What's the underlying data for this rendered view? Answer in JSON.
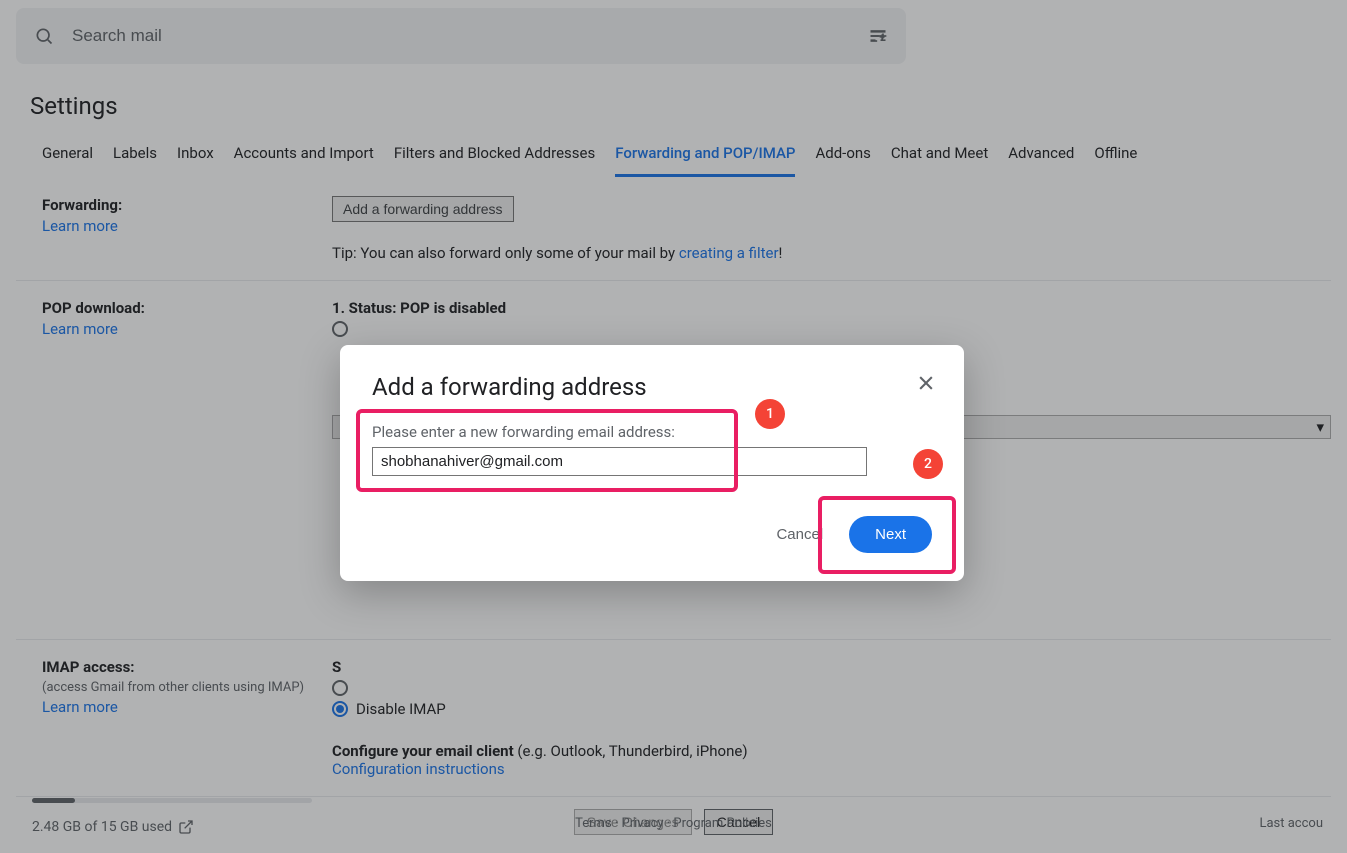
{
  "search": {
    "placeholder": "Search mail"
  },
  "page": {
    "title": "Settings"
  },
  "tabs": [
    {
      "label": "General"
    },
    {
      "label": "Labels"
    },
    {
      "label": "Inbox"
    },
    {
      "label": "Accounts and Import"
    },
    {
      "label": "Filters and Blocked Addresses"
    },
    {
      "label": "Forwarding and POP/IMAP",
      "active": true
    },
    {
      "label": "Add-ons"
    },
    {
      "label": "Chat and Meet"
    },
    {
      "label": "Advanced"
    },
    {
      "label": "Offline"
    }
  ],
  "forwarding": {
    "label": "Forwarding:",
    "learn_more": "Learn more",
    "add_button": "Add a forwarding address",
    "tip_pre": "Tip: You can also forward only some of your mail by ",
    "tip_link": "creating a filter",
    "tip_post": "!"
  },
  "pop": {
    "label": "POP download:",
    "learn_more": "Learn more",
    "status": "1. Status: POP is disabled"
  },
  "imap": {
    "label": "IMAP access:",
    "sub": "(access Gmail from other clients using IMAP)",
    "learn_more": "Learn more",
    "disable": "Disable IMAP",
    "config_label": "Configure your email client",
    "config_suffix": " (e.g. Outlook, Thunderbird, iPhone)",
    "config_link": "Configuration instructions"
  },
  "buttons": {
    "save": "Save Changes",
    "cancel": "Cancel"
  },
  "footer": {
    "terms": "Terms",
    "privacy": "Privacy",
    "program": "Program Policies",
    "last": "Last accou",
    "storage": "2.48 GB of 15 GB used"
  },
  "modal": {
    "title": "Add a forwarding address",
    "prompt": "Please enter a new forwarding email address:",
    "value": "shobhanahiver@gmail.com",
    "cancel": "Cancel",
    "next": "Next"
  },
  "anno": {
    "b1": "1",
    "b2": "2"
  }
}
